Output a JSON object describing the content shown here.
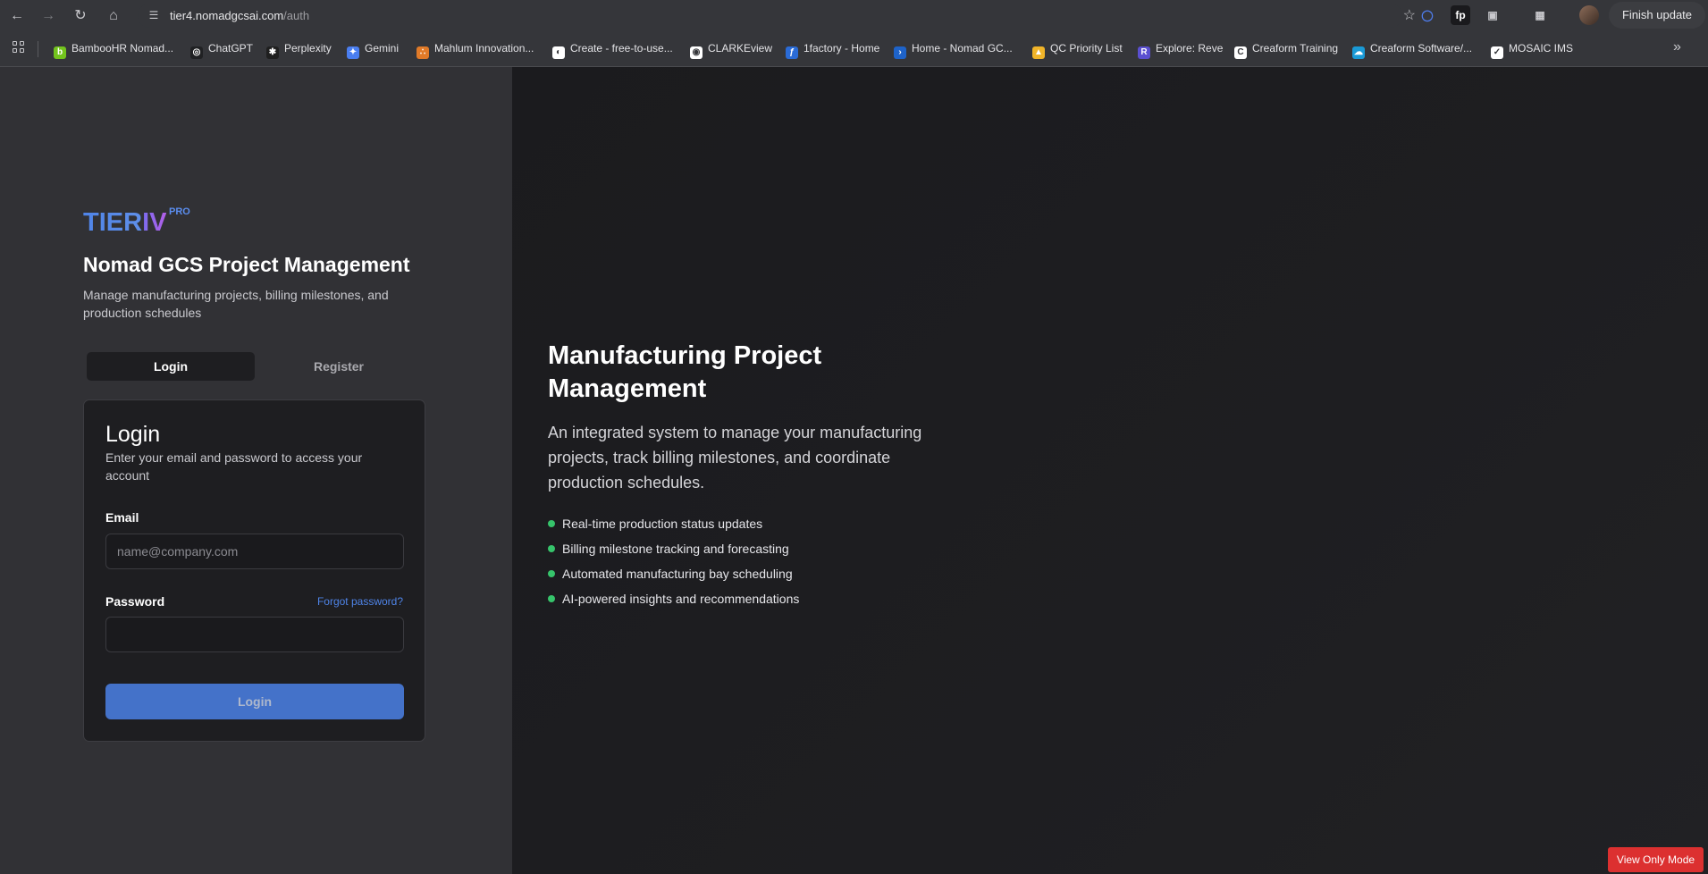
{
  "browser": {
    "url_host": "tier4.nomadgcsai.com",
    "url_path": "/auth",
    "finish_update_label": "Finish update",
    "bookmarks": [
      {
        "label": "BambooHR Nomad...",
        "color": "#73c41d"
      },
      {
        "label": "ChatGPT",
        "color": "#202123"
      },
      {
        "label": "Perplexity",
        "color": "#1f1f1f"
      },
      {
        "label": "Gemini",
        "color": "#4a7ef0"
      },
      {
        "label": "Mahlum Innovation...",
        "color": "#e07a28"
      },
      {
        "label": "Create - free-to-use...",
        "color": "#ffffff"
      },
      {
        "label": "CLARKEview",
        "color": "#ffffff"
      },
      {
        "label": "1factory - Home",
        "color": "#2a6bd6"
      },
      {
        "label": "Home - Nomad GC...",
        "color": "#1e63c9"
      },
      {
        "label": "QC Priority List",
        "color": "#f0b429"
      },
      {
        "label": "Explore: Reve",
        "color": "#5a4fd0"
      },
      {
        "label": "Creaform Training",
        "color": "#ffffff"
      },
      {
        "label": "Creaform Software/...",
        "color": "#1a9ad6"
      },
      {
        "label": "MOSAIC IMS",
        "color": "#ffffff"
      }
    ]
  },
  "brand": {
    "logo_tier": "TIER",
    "logo_iv": "IV",
    "logo_pro": "PRO",
    "app_title": "Nomad GCS Project Management",
    "app_subtitle": "Manage manufacturing projects, billing milestones, and production schedules"
  },
  "auth_tabs": {
    "login": "Login",
    "register": "Register"
  },
  "login_card": {
    "title": "Login",
    "description": "Enter your email and password to access your account",
    "email_label": "Email",
    "email_placeholder": "name@company.com",
    "email_value": "",
    "password_label": "Password",
    "password_value": "",
    "forgot_label": "Forgot password?",
    "submit_label": "Login"
  },
  "hero": {
    "title": "Manufacturing Project Management",
    "description": "An integrated system to manage your manufacturing projects, track billing milestones, and coordinate production schedules.",
    "features": [
      "Real-time production status updates",
      "Billing milestone tracking and forecasting",
      "Automated manufacturing bay scheduling",
      "AI-powered insights and recommendations"
    ],
    "bullet_color": "#36c46b"
  },
  "badge": {
    "view_only_label": "View Only Mode"
  },
  "colors": {
    "accent": "#4f84e8",
    "button": "#4472c9",
    "view_only": "#dc3030"
  }
}
